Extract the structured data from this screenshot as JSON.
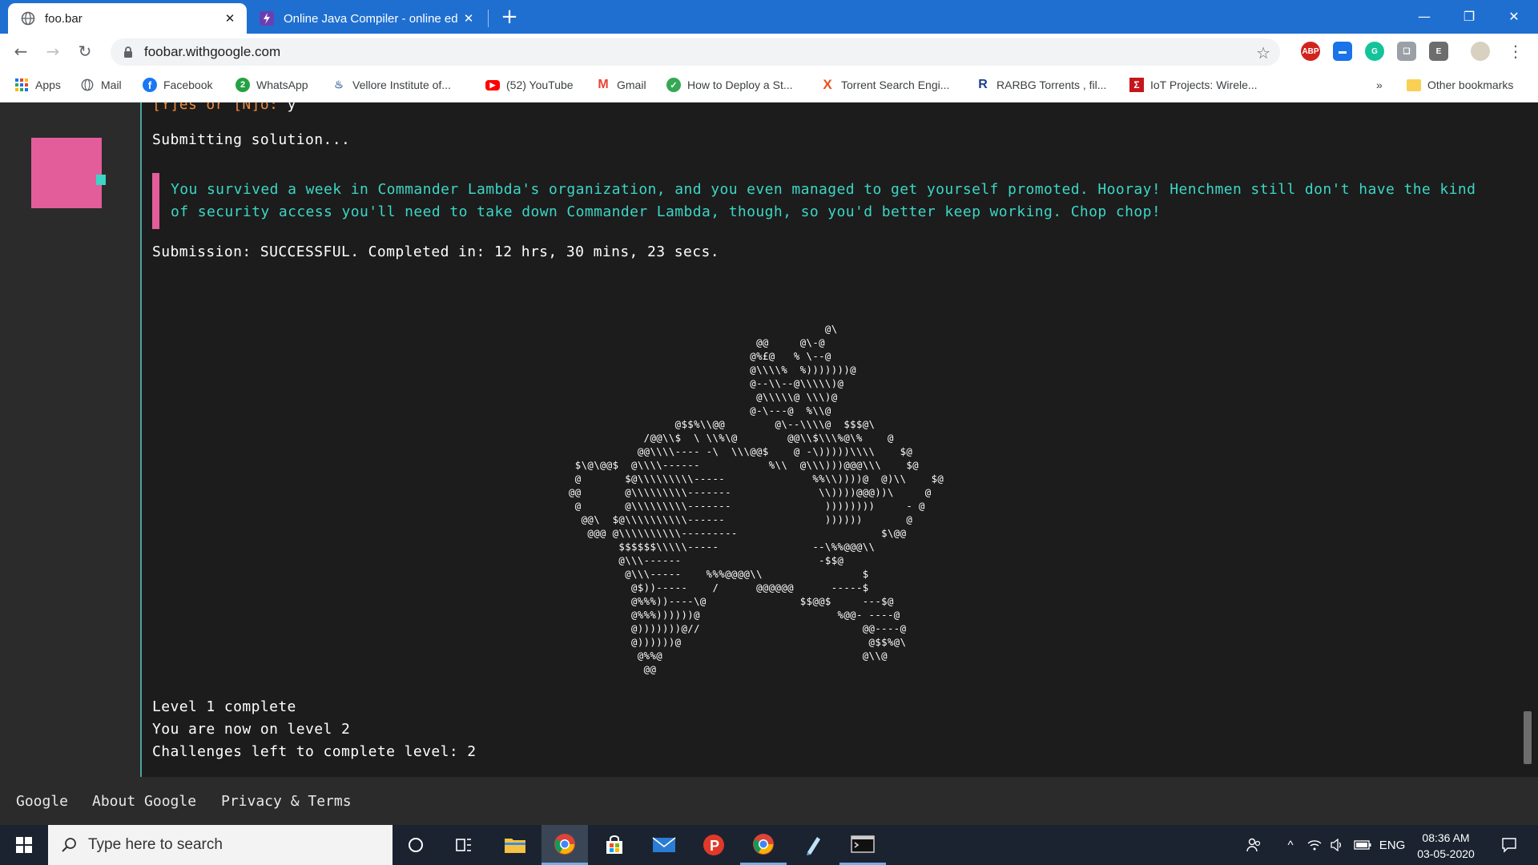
{
  "browser": {
    "tabs": [
      {
        "title": "foo.bar",
        "active": true
      },
      {
        "title": "Online Java Compiler - online ed",
        "active": false
      }
    ],
    "url": "foobar.withgoogle.com",
    "bookmarks": [
      {
        "label": "Apps"
      },
      {
        "label": "Mail"
      },
      {
        "label": "Facebook"
      },
      {
        "label": "WhatsApp"
      },
      {
        "label": "Vellore Institute of..."
      },
      {
        "label": "(52) YouTube"
      },
      {
        "label": "Gmail"
      },
      {
        "label": "How to Deploy a St..."
      },
      {
        "label": "Torrent Search Engi..."
      },
      {
        "label": "RARBG Torrents , fil..."
      },
      {
        "label": "IoT Projects: Wirele..."
      }
    ],
    "bookmarks_more": "»",
    "other_bookmarks": "Other bookmarks",
    "extensions": [
      "ABP",
      "E"
    ]
  },
  "terminal": {
    "prompt_prefix": "[Y]es or [N]o:",
    "prompt_answer": " y",
    "submitting": "Submitting solution...",
    "message": "You survived a week in Commander Lambda's organization, and you even managed to get yourself promoted. Hooray! Henchmen still don't have the kind of security access you'll need to take down Commander Lambda, though, so you'd better keep working. Chop chop!",
    "submission": "Submission: SUCCESSFUL. Completed in: 12 hrs, 30 mins, 23 secs.",
    "ascii_art": "                                         @\\\n                              @@     @\\-@\n                             @%£@   % \\--@\n                             @\\\\\\\\%  %)))))))@\n                             @--\\\\--@\\\\\\\\\\)@\n                              @\\\\\\\\\\@ \\\\\\)@\n                             @-\\---@  %\\\\@\n                 @$$%\\\\@@        @\\--\\\\\\\\@  $$$@\\\n            /@@\\\\$  \\ \\\\%\\@        @@\\\\$\\\\\\%@\\%    @\n           @@\\\\\\\\---- -\\  \\\\\\@@$    @ -\\)))))\\\\\\\\    $@\n $\\@\\@@$  @\\\\\\\\------           %\\\\  @\\\\\\)))@@@\\\\\\    $@\n @       $@\\\\\\\\\\\\\\\\\\-----              %%\\\\))))@  @)\\\\    $@\n@@       @\\\\\\\\\\\\\\\\\\-------              \\\\))))@@@))\\     @\n @       @\\\\\\\\\\\\\\\\\\-------               ))))))))     - @\n  @@\\  $@\\\\\\\\\\\\\\\\\\\\------                ))))))       @\n   @@@ @\\\\\\\\\\\\\\\\\\\\---------                       $\\@@\n        $$$$$$\\\\\\\\\\-----               --\\%%@@@\\\\\n        @\\\\\\------                      -$$@\n         @\\\\\\-----    %%%@@@@\\\\                $\n          @$))-----    /      @@@@@@      -----$\n          @%%%))----\\@               $$@@$     ---$@\n          @%%%))))))@                      %@@- ----@\n          @)))))))@//                          @@----@\n          @))))))@                              @$$%@\\\n           @%%@                                @\\\\@\n            @@",
    "level_complete": "Level 1 complete",
    "now_on_level": "You are now on level 2",
    "challenges_left": "Challenges left to complete level: 2"
  },
  "footer": {
    "links": [
      "Google",
      "About Google",
      "Privacy & Terms"
    ]
  },
  "taskbar": {
    "search_placeholder": "Type here to search",
    "language": "ENG",
    "time": "08:36 AM",
    "date": "03-05-2020"
  },
  "colors": {
    "tab_strip": "#1f6fd1",
    "terminal_text": "#ffffff",
    "prompt_orange": "#ef8a3e",
    "message_teal": "#3cd6c6",
    "accent_pink": "#e35d9a",
    "border_teal": "#4aa3a3"
  }
}
